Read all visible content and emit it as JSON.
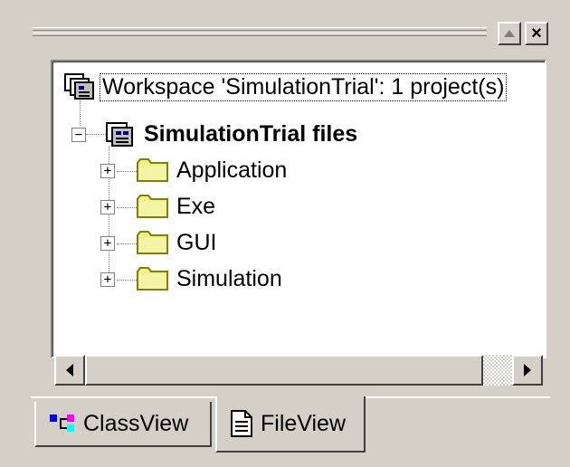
{
  "panel": {
    "maximize_icon": "maximize-triangle-icon",
    "close_label": "×"
  },
  "tree": {
    "workspace_label": "Workspace 'SimulationTrial': 1 project(s)",
    "project_label": "SimulationTrial files",
    "folders": [
      {
        "label": "Application"
      },
      {
        "label": "Exe"
      },
      {
        "label": "GUI"
      },
      {
        "label": "Simulation"
      }
    ],
    "expand_symbol": "+",
    "collapse_symbol": "−"
  },
  "tabs": [
    {
      "label": "ClassView",
      "icon": "classview-icon",
      "active": false
    },
    {
      "label": "FileView",
      "icon": "fileview-icon",
      "active": true
    }
  ],
  "colors": {
    "folder_fill": "#f2f08a",
    "folder_outline": "#808000",
    "face": "#d4d0c8"
  }
}
